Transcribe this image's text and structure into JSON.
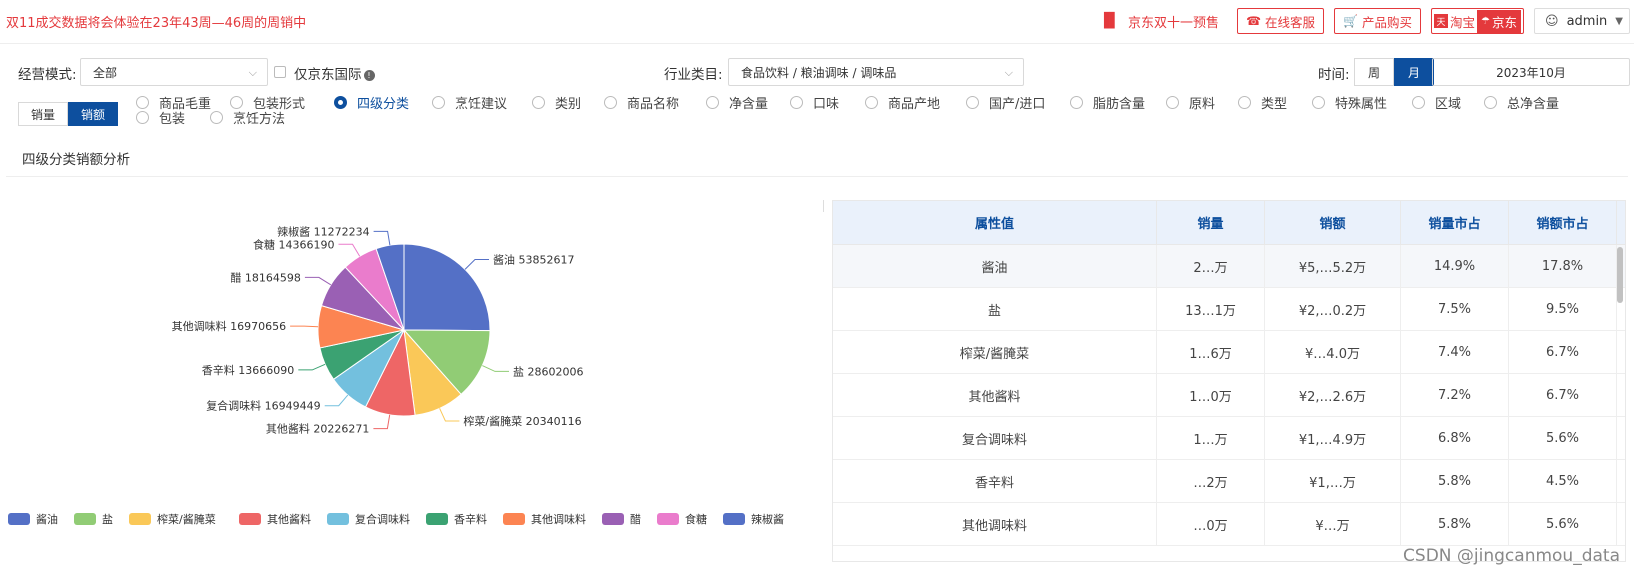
{
  "topbar": {
    "notice": "双11成交数据将会体验在23年43周—46周的周销中",
    "jd_presale": "京东双十一预售",
    "customer_service": "在线客服",
    "buy_product": "产品购买",
    "taobao": "淘宝",
    "jd": "京东",
    "user": "admin"
  },
  "filters": {
    "mode_label": "经营模式:",
    "mode_value": "全部",
    "jd_intl": "仅京东国际",
    "industry_label": "行业类目:",
    "industry_value": "食品饮料 / 粮油调味 / 调味品",
    "time_label": "时间:",
    "week": "周",
    "month": "月",
    "date_value": "2023年10月",
    "metric_qty": "销量",
    "metric_amt": "销额"
  },
  "attributes": [
    "商品毛重",
    "包装形式",
    "四级分类",
    "烹饪建议",
    "类别",
    "商品名称",
    "净含量",
    "口味",
    "商品产地",
    "国产/进口",
    "脂肪含量",
    "原料",
    "类型",
    "特殊属性",
    "区域",
    "总净含量",
    "包装",
    "烹饪方法"
  ],
  "selected_attribute": "四级分类",
  "section_title": "四级分类销额分析",
  "colors": [
    "#5470c6",
    "#91cc75",
    "#fac858",
    "#ee6666",
    "#73c0de",
    "#3ba272",
    "#fc8452",
    "#9a60b4",
    "#ea7ccc",
    "#5470c6"
  ],
  "chart_data": {
    "type": "pie",
    "categories": [
      "酱油",
      "盐",
      "榨菜/酱腌菜",
      "其他酱料",
      "复合调味料",
      "香辛料",
      "其他调味料",
      "醋",
      "食糖",
      "辣椒酱"
    ],
    "values": [
      53852617,
      28602006,
      20340116,
      20226271,
      16949449,
      13666090,
      16970656,
      18164598,
      14366190,
      11272234
    ],
    "legend_position": "bottom"
  },
  "table": {
    "headers": [
      "属性值",
      "销量",
      "销额",
      "销量市占",
      "销额市占"
    ],
    "rows": [
      [
        "酱油",
        "2…万",
        "¥5,…5.2万",
        "14.9%",
        "17.8%"
      ],
      [
        "盐",
        "13…1万",
        "¥2,…0.2万",
        "7.5%",
        "9.5%"
      ],
      [
        "榨菜/酱腌菜",
        "1…6万",
        "¥…4.0万",
        "7.4%",
        "6.7%"
      ],
      [
        "其他酱料",
        "1…0万",
        "¥2,…2.6万",
        "7.2%",
        "6.7%"
      ],
      [
        "复合调味料",
        "1…万",
        "¥1,…4.9万",
        "6.8%",
        "5.6%"
      ],
      [
        "香辛料",
        "…2万",
        "¥1,…万",
        "5.8%",
        "4.5%"
      ],
      [
        "其他调味料",
        "…0万",
        "¥…万",
        "5.8%",
        "5.6%"
      ]
    ]
  },
  "watermark": "CSDN @jingcanmou_data"
}
